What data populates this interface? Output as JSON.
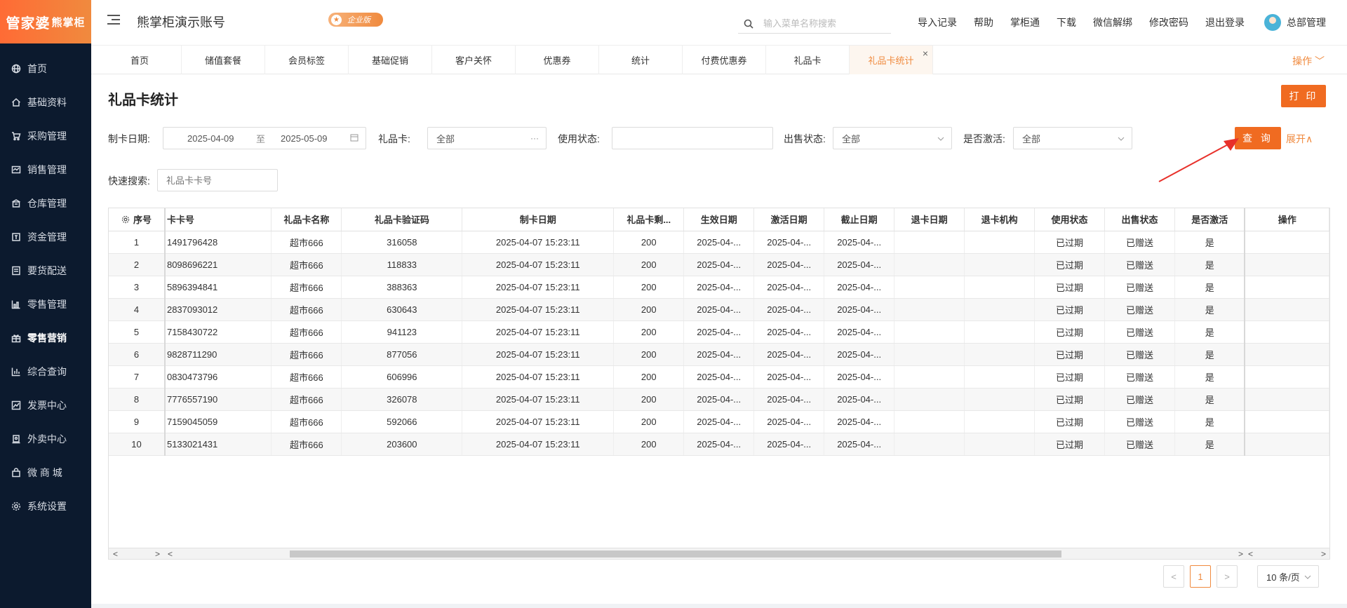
{
  "sidebar": {
    "logo_main": "管家婆",
    "logo_sub": "熊掌柜",
    "items": [
      {
        "label": "首页",
        "icon": "globe-icon"
      },
      {
        "label": "基础资料",
        "icon": "home-icon"
      },
      {
        "label": "采购管理",
        "icon": "cart-icon"
      },
      {
        "label": "销售管理",
        "icon": "sales-icon"
      },
      {
        "label": "仓库管理",
        "icon": "warehouse-icon"
      },
      {
        "label": "资金管理",
        "icon": "money-icon"
      },
      {
        "label": "要货配送",
        "icon": "list-icon"
      },
      {
        "label": "零售管理",
        "icon": "chart-icon"
      },
      {
        "label": "零售营销",
        "icon": "gift-icon"
      },
      {
        "label": "综合查询",
        "icon": "bar-icon"
      },
      {
        "label": "发票中心",
        "icon": "trend-icon"
      },
      {
        "label": "外卖中心",
        "icon": "delivery-icon"
      },
      {
        "label": "微 商 城",
        "icon": "shop-icon"
      },
      {
        "label": "系统设置",
        "icon": "gear-icon"
      }
    ]
  },
  "header": {
    "title": "熊掌柜演示账号",
    "badge": "企业版",
    "search_placeholder": "输入菜单名称搜索",
    "links": [
      "导入记录",
      "帮助",
      "掌柜通",
      "下载",
      "微信解绑",
      "修改密码",
      "退出登录"
    ],
    "user": "总部管理"
  },
  "tabs": {
    "items": [
      "首页",
      "储值套餐",
      "会员标签",
      "基础促销",
      "客户关怀",
      "优惠券",
      "统计",
      "付费优惠券",
      "礼品卡",
      "礼品卡统计"
    ],
    "close": "×",
    "operation": "操作 ﹀"
  },
  "page": {
    "title": "礼品卡统计",
    "print": "打 印"
  },
  "filters": {
    "date_label": "制卡日期:",
    "date_from": "2025-04-09",
    "date_sep": "至",
    "date_to": "2025-05-09",
    "card_label": "礼品卡:",
    "card_value": "全部",
    "card_suffix": "···",
    "use_label": "使用状态:",
    "use_value": "",
    "sale_label": "出售状态:",
    "sale_value": "全部",
    "active_label": "是否激活:",
    "active_value": "全部",
    "query": "查 询",
    "expand": "展开∧",
    "quick_label": "快速搜索:",
    "quick_placeholder": "礼品卡卡号"
  },
  "table": {
    "columns": [
      "序号",
      "卡卡号",
      "礼品卡名称",
      "礼品卡验证码",
      "制卡日期",
      "礼品卡剩...",
      "生效日期",
      "激活日期",
      "截止日期",
      "退卡日期",
      "退卡机构",
      "使用状态",
      "出售状态",
      "是否激活",
      "操作"
    ],
    "rows": [
      [
        "1",
        "1491796428",
        "超市666",
        "316058",
        "2025-04-07 15:23:11",
        "200",
        "2025-04-...",
        "2025-04-...",
        "2025-04-...",
        "",
        "",
        "已过期",
        "已赠送",
        "是",
        ""
      ],
      [
        "2",
        "8098696221",
        "超市666",
        "118833",
        "2025-04-07 15:23:11",
        "200",
        "2025-04-...",
        "2025-04-...",
        "2025-04-...",
        "",
        "",
        "已过期",
        "已赠送",
        "是",
        ""
      ],
      [
        "3",
        "5896394841",
        "超市666",
        "388363",
        "2025-04-07 15:23:11",
        "200",
        "2025-04-...",
        "2025-04-...",
        "2025-04-...",
        "",
        "",
        "已过期",
        "已赠送",
        "是",
        ""
      ],
      [
        "4",
        "2837093012",
        "超市666",
        "630643",
        "2025-04-07 15:23:11",
        "200",
        "2025-04-...",
        "2025-04-...",
        "2025-04-...",
        "",
        "",
        "已过期",
        "已赠送",
        "是",
        ""
      ],
      [
        "5",
        "7158430722",
        "超市666",
        "941123",
        "2025-04-07 15:23:11",
        "200",
        "2025-04-...",
        "2025-04-...",
        "2025-04-...",
        "",
        "",
        "已过期",
        "已赠送",
        "是",
        ""
      ],
      [
        "6",
        "9828711290",
        "超市666",
        "877056",
        "2025-04-07 15:23:11",
        "200",
        "2025-04-...",
        "2025-04-...",
        "2025-04-...",
        "",
        "",
        "已过期",
        "已赠送",
        "是",
        ""
      ],
      [
        "7",
        "0830473796",
        "超市666",
        "606996",
        "2025-04-07 15:23:11",
        "200",
        "2025-04-...",
        "2025-04-...",
        "2025-04-...",
        "",
        "",
        "已过期",
        "已赠送",
        "是",
        ""
      ],
      [
        "8",
        "7776557190",
        "超市666",
        "326078",
        "2025-04-07 15:23:11",
        "200",
        "2025-04-...",
        "2025-04-...",
        "2025-04-...",
        "",
        "",
        "已过期",
        "已赠送",
        "是",
        ""
      ],
      [
        "9",
        "7159045059",
        "超市666",
        "592066",
        "2025-04-07 15:23:11",
        "200",
        "2025-04-...",
        "2025-04-...",
        "2025-04-...",
        "",
        "",
        "已过期",
        "已赠送",
        "是",
        ""
      ],
      [
        "10",
        "5133021431",
        "超市666",
        "203600",
        "2025-04-07 15:23:11",
        "200",
        "2025-04-...",
        "2025-04-...",
        "2025-04-...",
        "",
        "",
        "已过期",
        "已赠送",
        "是",
        ""
      ]
    ]
  },
  "pager": {
    "prev": "<",
    "current": "1",
    "next": ">",
    "size": "10 条/页"
  },
  "colors": {
    "accent": "#f06b21",
    "sidebar_bg": "#0c1a2e",
    "annotation_arrow": "#e8302a"
  }
}
